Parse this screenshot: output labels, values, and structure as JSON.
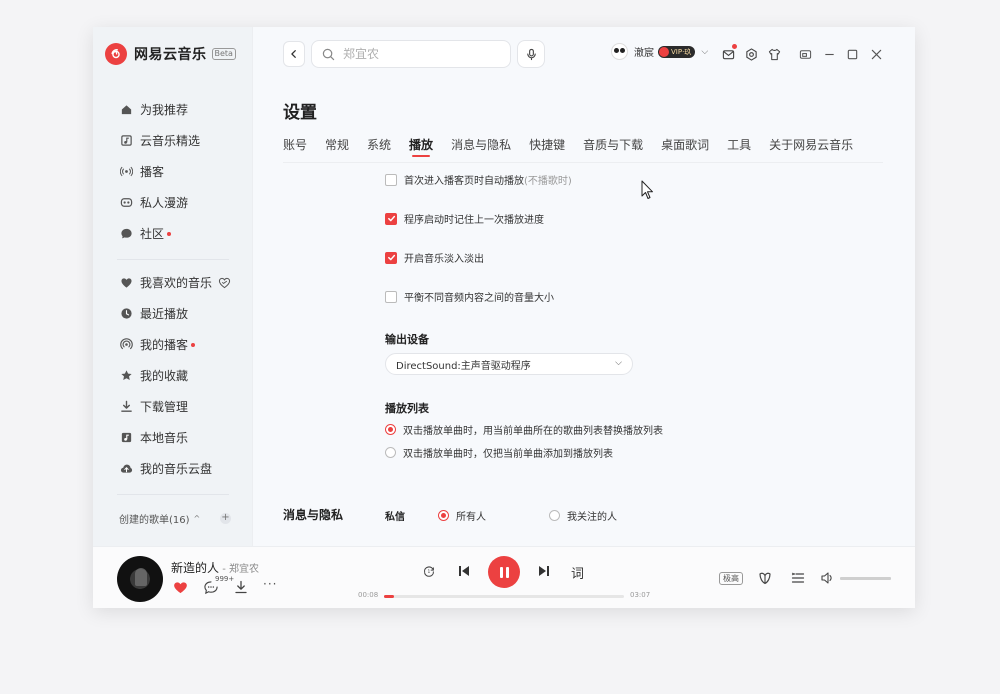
{
  "app": {
    "name": "网易云音乐",
    "beta": "Beta"
  },
  "sidebar": {
    "items": [
      {
        "label": "为我推荐",
        "icon": "home-icon",
        "dot": false
      },
      {
        "label": "云音乐精选",
        "icon": "music-note-icon",
        "dot": false
      },
      {
        "label": "播客",
        "icon": "podcast-icon",
        "dot": false
      },
      {
        "label": "私人漫游",
        "icon": "roam-icon",
        "dot": false
      },
      {
        "label": "社区",
        "icon": "community-icon",
        "dot": true
      }
    ],
    "my_items": [
      {
        "label": "我喜欢的音乐",
        "icon": "heart-icon",
        "dot": false
      },
      {
        "label": "最近播放",
        "icon": "clock-icon",
        "dot": false
      },
      {
        "label": "我的播客",
        "icon": "my-podcast-icon",
        "dot": true
      },
      {
        "label": "我的收藏",
        "icon": "star-icon",
        "dot": false
      },
      {
        "label": "下载管理",
        "icon": "download-icon",
        "dot": false
      },
      {
        "label": "本地音乐",
        "icon": "local-music-icon",
        "dot": false
      },
      {
        "label": "我的音乐云盘",
        "icon": "cloud-icon",
        "dot": false
      }
    ],
    "playlist_header": "创建的歌单(16)"
  },
  "header": {
    "search_placeholder": "郑宜农",
    "username": "澈宸",
    "vip_label": "VIP·玖"
  },
  "settings": {
    "title": "设置",
    "tabs": [
      {
        "label": "账号",
        "active": false
      },
      {
        "label": "常规",
        "active": false
      },
      {
        "label": "系统",
        "active": false
      },
      {
        "label": "播放",
        "active": true
      },
      {
        "label": "消息与隐私",
        "active": false
      },
      {
        "label": "快捷键",
        "active": false
      },
      {
        "label": "音质与下载",
        "active": false
      },
      {
        "label": "桌面歌词",
        "active": false
      },
      {
        "label": "工具",
        "active": false
      },
      {
        "label": "关于网易云音乐",
        "active": false
      }
    ],
    "options": [
      {
        "label": "首次进入播客页时自动播放",
        "note": "(不播歌时)",
        "checked": false
      },
      {
        "label": "程序启动时记住上一次播放进度",
        "note": "",
        "checked": true
      },
      {
        "label": "开启音乐淡入淡出",
        "note": "",
        "checked": true
      },
      {
        "label": "平衡不同音频内容之间的音量大小",
        "note": "",
        "checked": false
      }
    ],
    "output_device": {
      "label": "输出设备",
      "value": "DirectSound:主声音驱动程序"
    },
    "playlist": {
      "label": "播放列表",
      "options": [
        {
          "label": "双击播放单曲时，用当前单曲所在的歌曲列表替换播放列表",
          "selected": true
        },
        {
          "label": "双击播放单曲时，仅把当前单曲添加到播放列表",
          "selected": false
        }
      ]
    },
    "privacy": {
      "section_title": "消息与隐私",
      "label": "私信",
      "options": [
        {
          "label": "所有人",
          "selected": true
        },
        {
          "label": "我关注的人",
          "selected": false
        }
      ]
    }
  },
  "player": {
    "song_title": "新造的人",
    "separator": " - ",
    "artist": "郑宜农",
    "comment_count": "999+",
    "current_time": "00:08",
    "total_time": "03:07",
    "progress": 0.04,
    "lyric_label": "词",
    "quality": "极高",
    "volume": 1.0
  },
  "colors": {
    "accent": "#ec4141",
    "sidebar_bg": "#f0f3f6",
    "content_bg": "#f7f9fc"
  }
}
